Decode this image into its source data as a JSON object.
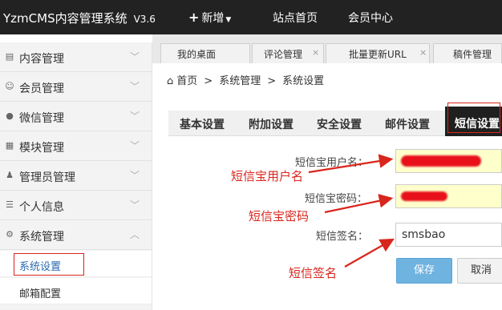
{
  "header": {
    "brand": "YzmCMS内容管理系统",
    "version": "V3.6",
    "nav": [
      "新增",
      "站点首页",
      "会员中心"
    ]
  },
  "sidebar": {
    "items": [
      {
        "label": "内容管理",
        "icon": "file-icon"
      },
      {
        "label": "会员管理",
        "icon": "user-icon"
      },
      {
        "label": "微信管理",
        "icon": "wechat-icon"
      },
      {
        "label": "模块管理",
        "icon": "grid-icon"
      },
      {
        "label": "管理员管理",
        "icon": "admin-user-icon"
      },
      {
        "label": "个人信息",
        "icon": "list-icon"
      },
      {
        "label": "系统管理",
        "icon": "gear-icon"
      }
    ],
    "sub_items": [
      "系统设置",
      "邮箱配置"
    ]
  },
  "window_tabs": [
    "我的桌面",
    "评论管理",
    "批量更新URL",
    "稿件管理"
  ],
  "breadcrumb": [
    "首页",
    "系统管理",
    "系统设置"
  ],
  "settings_tabs": [
    "基本设置",
    "附加设置",
    "安全设置",
    "邮件设置",
    "短信设置"
  ],
  "form": {
    "user_label": "短信宝用户名：",
    "pass_label": "短信宝密码：",
    "sign_label": "短信签名：",
    "sign_value": "smsbao"
  },
  "annotations": [
    "短信宝用户名",
    "短信宝密码",
    "短信签名"
  ],
  "buttons": {
    "save": "保存",
    "cancel": "取消"
  },
  "colors": {
    "accent": "#d9261c",
    "topbar": "#222222",
    "save": "#6fb3e0"
  }
}
